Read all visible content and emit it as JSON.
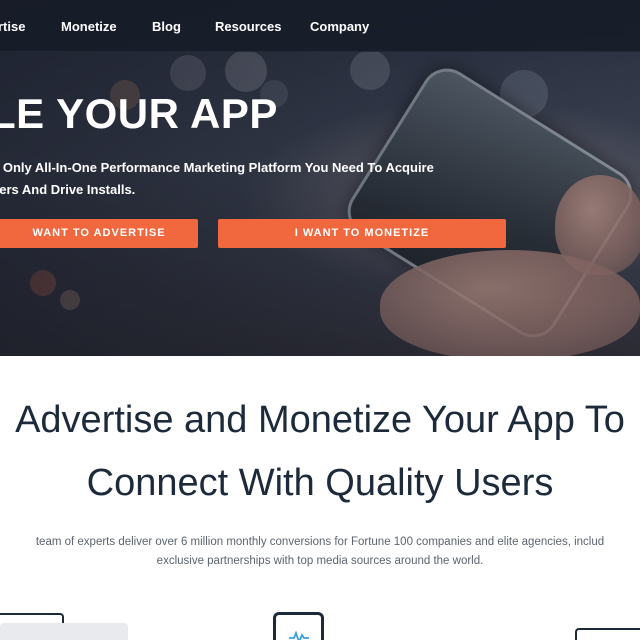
{
  "nav": {
    "items": [
      {
        "label": "rtise",
        "name": "nav-advertise"
      },
      {
        "label": "Monetize",
        "name": "nav-monetize"
      },
      {
        "label": "Blog",
        "name": "nav-blog"
      },
      {
        "label": "Resources",
        "name": "nav-resources"
      },
      {
        "label": "Company",
        "name": "nav-company"
      }
    ]
  },
  "hero": {
    "title": "LE YOUR APP",
    "subtitle_line1": "e Only All-In-One Performance Marketing Platform You Need To Acquire",
    "subtitle_line2": "sers And Drive Installs.",
    "advertise_button": "WANT TO ADVERTISE",
    "monetize_button": "I WANT TO MONETIZE"
  },
  "section": {
    "headline_line1": "Advertise and Monetize Your App To",
    "headline_line2": "Connect With Quality Users",
    "desc_line1": "team of experts deliver over 6 million monthly conversions for Fortune 100 companies and elite agencies, includ",
    "desc_line2": "exclusive partnerships with top media sources around the world."
  },
  "icons": [
    "laptop-icon",
    "phone-analytics-icon",
    "monitor-icon"
  ],
  "colors": {
    "accent": "#f2683e",
    "nav_bg": "#161c28",
    "headline": "#1c2a3b",
    "body_text": "#5b6470"
  }
}
